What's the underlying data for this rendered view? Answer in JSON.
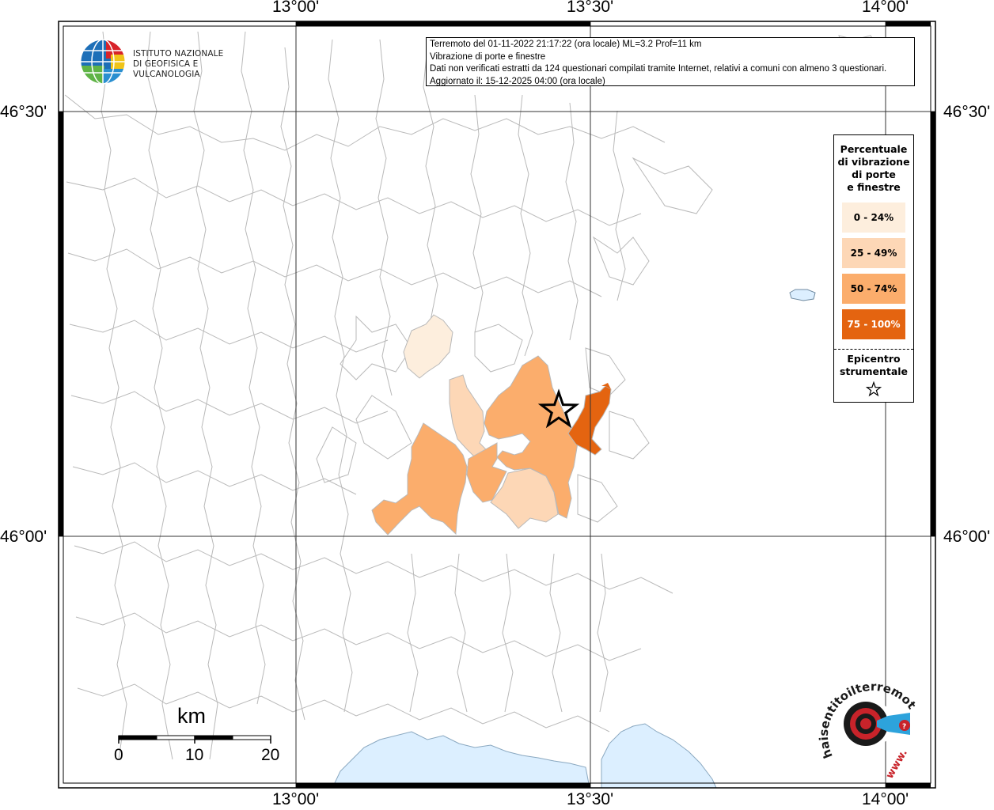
{
  "map": {
    "longitude_labels": [
      "13°00'",
      "13°30'",
      "14°00'"
    ],
    "latitude_labels": [
      "46°30'",
      "46°00'"
    ],
    "colors": {
      "municipality_border": "#b9b9b9",
      "sea": "#dcefff",
      "class_0_24": "#fdeedd",
      "class_25_49": "#fdd7b6",
      "class_50_74": "#fbad6c",
      "class_75_100": "#e46410"
    }
  },
  "info": {
    "line1": "Terremoto del 01-11-2022 21:17:22 (ora locale) ML=3.2 Prof=11 km",
    "line2": "Vibrazione di porte e finestre",
    "line3": "Dati non verificati estratti da 124 questionari compilati tramite Internet, relativi a comuni con almeno 3 questionari.",
    "line4": "Aggiornato il: 15-12-2025 04:00 (ora locale)"
  },
  "logo": {
    "line1": "ISTITUTO NAZIONALE",
    "line2": "DI GEOFISICA E VULCANOLOGIA"
  },
  "legend": {
    "title_lines": [
      "Percentuale",
      "di vibrazione",
      "di porte",
      "e finestre"
    ],
    "items": [
      {
        "label": "0 - 24%",
        "color": "#fdeedd",
        "text_color": "#000000"
      },
      {
        "label": "25 - 49%",
        "color": "#fdd7b6",
        "text_color": "#000000"
      },
      {
        "label": "50 - 74%",
        "color": "#fbad6c",
        "text_color": "#000000"
      },
      {
        "label": "75 - 100%",
        "color": "#e46410",
        "text_color": "#ffffff"
      }
    ],
    "epicenter_lines": [
      "Epicentro",
      "strumentale"
    ],
    "epicenter_icon": "star-icon"
  },
  "scalebar": {
    "unit": "km",
    "labels": [
      "0",
      "10",
      "20"
    ]
  },
  "brand": {
    "text": "haisentitoilterremoto.it",
    "www": "www.",
    "icon": "seismic-target-icon"
  }
}
